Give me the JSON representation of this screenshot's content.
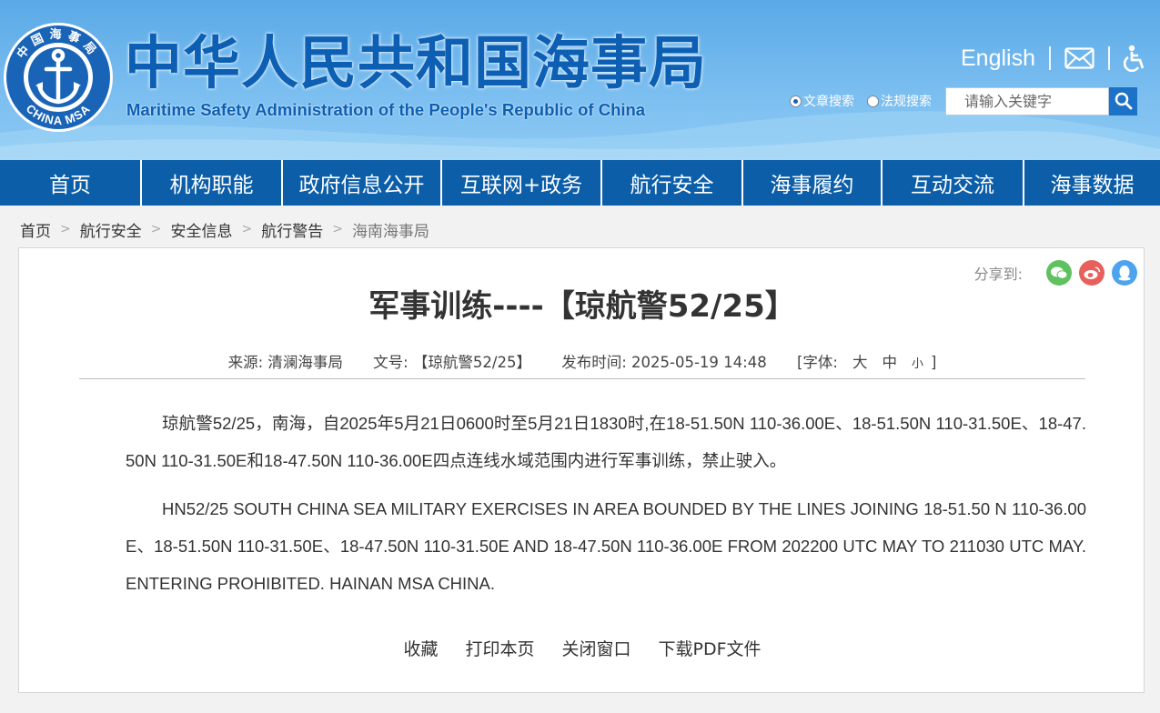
{
  "header": {
    "logo_text": "中国海事局",
    "logo_en": "CHINA MSA",
    "cn_title": "中华人民共和国海事局",
    "en_title": "Maritime Safety Administration of the People's Republic of China",
    "english_link": "English",
    "search": {
      "option_article": "文章搜索",
      "option_law": "法规搜索",
      "selected": "文章搜索",
      "placeholder": "请输入关键字"
    }
  },
  "nav": {
    "items": [
      "首页",
      "机构职能",
      "政府信息公开",
      "互联网+政务",
      "航行安全",
      "海事履约",
      "互动交流",
      "海事数据"
    ]
  },
  "breadcrumb": {
    "items": [
      "首页",
      "航行安全",
      "安全信息",
      "航行警告",
      "海南海事局"
    ]
  },
  "article": {
    "share_label": "分享到:",
    "title": "军事训练----【琼航警52/25】",
    "meta": {
      "source": "来源: 清澜海事局",
      "doc_no": "文号: 【琼航警52/25】",
      "published": "发布时间: 2025-05-19 14:48",
      "font_label": "[字体:",
      "font_large": "大",
      "font_medium": "中",
      "font_small": "小",
      "font_close": "]"
    },
    "paragraph_cn": "琼航警52/25，南海，自2025年5月21日0600时至5月21日1830时,在18-51.50N 110-36.00E、18-51.50N 110-31.50E、18-47.50N 110-31.50E和18-47.50N 110-36.00E四点连线水域范围内进行军事训练，禁止驶入。",
    "paragraph_en": "HN52/25 SOUTH CHINA SEA MILITARY EXERCISES IN AREA BOUNDED BY THE LINES JOINING 18-51.50 N 110-36.00E、18-51.50N 110-31.50E、18-47.50N 110-31.50E AND 18-47.50N 110-36.00E FROM 202200 UTC MAY TO 211030 UTC   MAY. ENTERING PROHIBITED. HAINAN MSA CHINA.",
    "actions": {
      "favorite": "收藏",
      "print": "打印本页",
      "close": "关闭窗口",
      "download_pdf": "下载PDF文件"
    }
  },
  "colors": {
    "brand_blue": "#0c5ea8",
    "title_blue": "#0d5fb4",
    "wechat_green": "#5fc15f",
    "weibo_red": "#e8605c",
    "qq_blue": "#4da3ee"
  }
}
